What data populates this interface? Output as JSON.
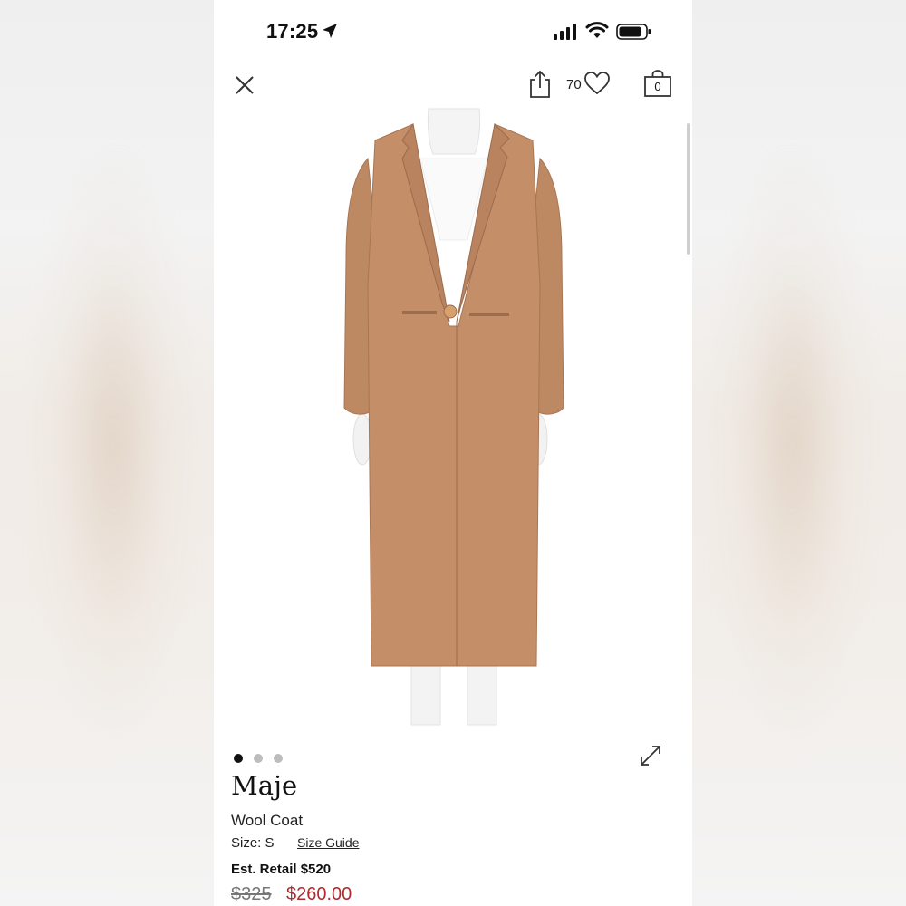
{
  "status_bar": {
    "time": "17:25",
    "location_icon": "location-arrow-icon",
    "signal_icon": "cellular-signal-icon",
    "wifi_icon": "wifi-icon",
    "battery_icon": "battery-icon"
  },
  "nav": {
    "close_icon": "close-icon",
    "share_icon": "share-icon",
    "likes_count": "70",
    "heart_icon": "heart-icon",
    "bag_icon": "shopping-bag-icon",
    "bag_count": "0"
  },
  "gallery": {
    "slide_count": 3,
    "active_index": 0,
    "expand_icon": "expand-arrows-icon"
  },
  "product": {
    "brand": "Maje",
    "name": "Wool Coat",
    "size_label": "Size: S",
    "size_guide": "Size Guide",
    "est_retail": "Est. Retail $520",
    "original_price": "$325",
    "sale_price": "$260.00"
  },
  "colors": {
    "sale_price": "#b3282d",
    "coat": "#c38e68",
    "text": "#111111"
  }
}
